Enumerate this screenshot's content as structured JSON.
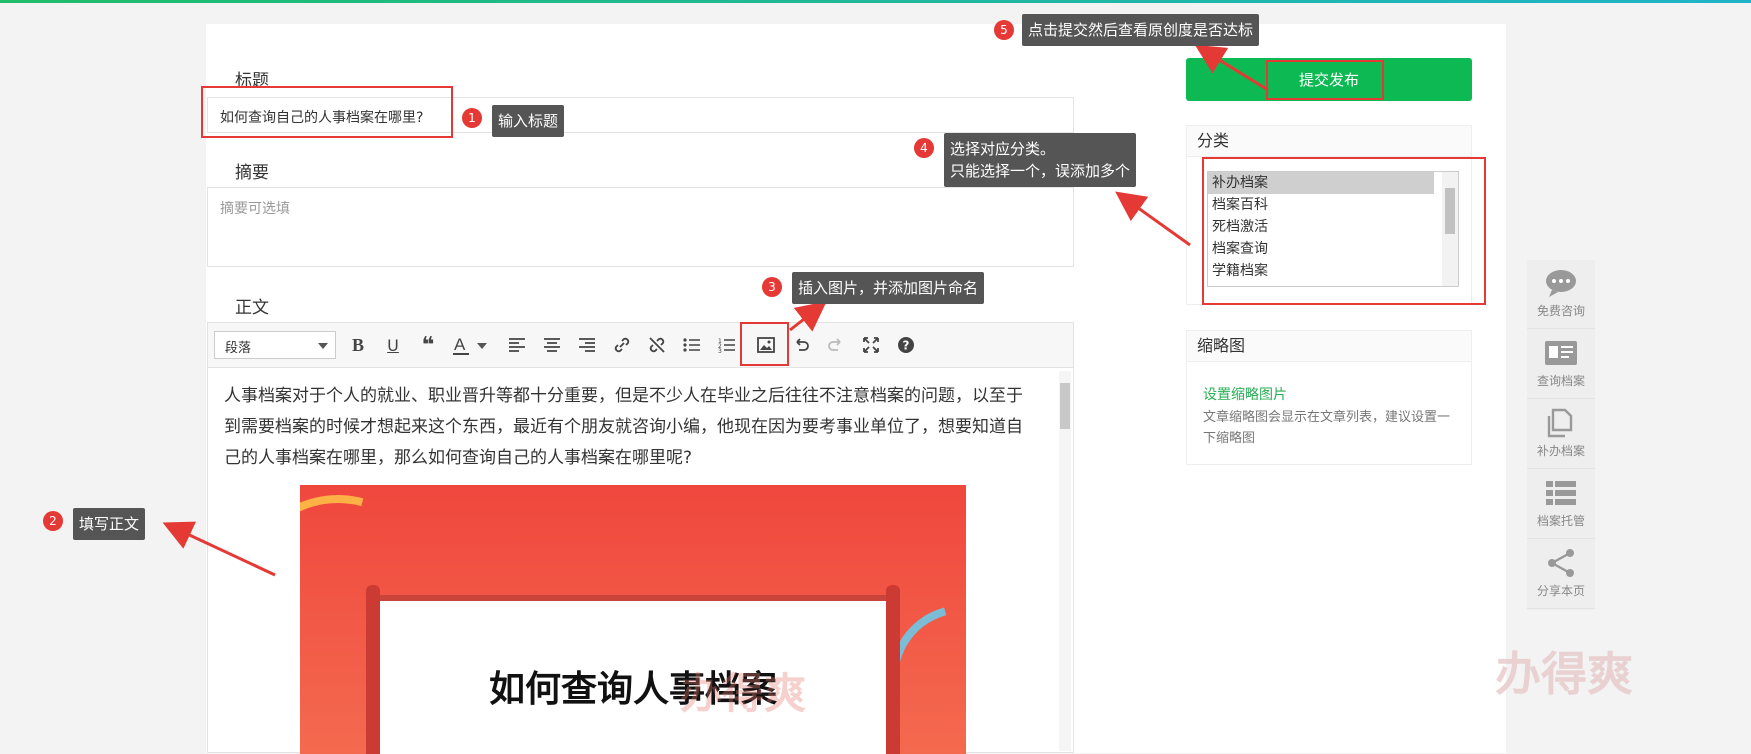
{
  "form": {
    "title_label": "标题",
    "title_value": "如何查询自己的人事档案在哪里?",
    "summary_label": "摘要",
    "summary_placeholder": "摘要可选填",
    "body_label": "正文",
    "paragraph_select": "段落",
    "body_text": "人事档案对于个人的就业、职业晋升等都十分重要，但是不少人在毕业之后往往不注意档案的问题，以至于到需要档案的时候才想起来这个东西，最近有个朋友就咨询小编，他现在因为要考事业单位了，想要知道自己的人事档案在哪里，那么如何查询自己的人事档案在哪里呢?",
    "poster_heading": "如何查询人事档案",
    "poster_watermark": "办得爽"
  },
  "sidebar": {
    "submit_label": "提交发布",
    "category_header": "分类",
    "categories": [
      "补办档案",
      "档案百科",
      "死档激活",
      "档案查询",
      "学籍档案"
    ],
    "thumbnail_header": "缩略图",
    "thumbnail_link": "设置缩略图片",
    "thumbnail_desc": "文章缩略图会显示在文章列表，建议设置一下缩略图"
  },
  "float_menu": [
    {
      "label": "免费咨询",
      "icon": "chat-icon"
    },
    {
      "label": "查询档案",
      "icon": "id-card-icon"
    },
    {
      "label": "补办档案",
      "icon": "copy-icon"
    },
    {
      "label": "档案托管",
      "icon": "list-icon"
    },
    {
      "label": "分享本页",
      "icon": "share-icon"
    }
  ],
  "watermark": "办得爽",
  "callouts": {
    "c1": {
      "num": "1",
      "text": "输入标题"
    },
    "c2": {
      "num": "2",
      "text": "填写正文"
    },
    "c3": {
      "num": "3",
      "text": "插入图片，并添加图片命名"
    },
    "c4": {
      "num": "4",
      "line1": "选择对应分类。",
      "line2": "只能选择一个，误添加多个"
    },
    "c5": {
      "num": "5",
      "text": "点击提交然后查看原创度是否达标"
    }
  },
  "colors": {
    "accent": "#0db952",
    "annotation_red": "#e53935",
    "callout_bg": "#555555"
  }
}
